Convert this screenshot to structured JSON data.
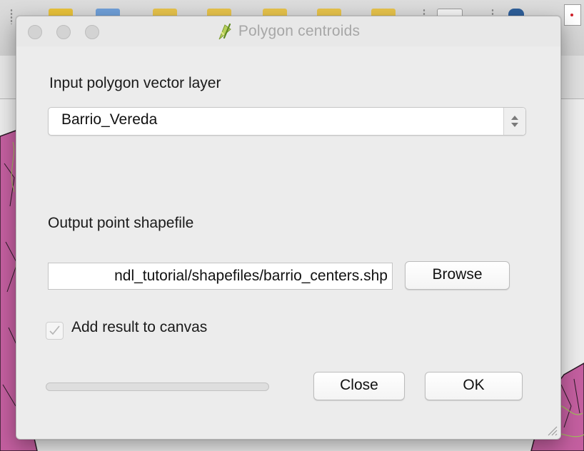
{
  "dialog": {
    "title": "Polygon centroids",
    "input_layer_label": "Input polygon vector layer",
    "input_layer_value": "Barrio_Vereda",
    "output_label": "Output point shapefile",
    "output_path": "ndl_tutorial/shapefiles/barrio_centers.shp",
    "browse_label": "Browse",
    "add_to_canvas_label": "Add result to canvas",
    "add_to_canvas_checked": true,
    "progress_percent": 0,
    "close_label": "Close",
    "ok_label": "OK"
  },
  "colors": {
    "map_fill": "#c45fa0",
    "map_border": "#2a1a25",
    "map_green": "#9fbf5a",
    "progress_fill": "#3b8ee0"
  },
  "icons": {
    "title_icon": "qgis-processing-icon",
    "combo_arrows": "up-down-arrows-icon",
    "checkmark": "checkmark-icon",
    "resize": "resize-grip-icon"
  }
}
